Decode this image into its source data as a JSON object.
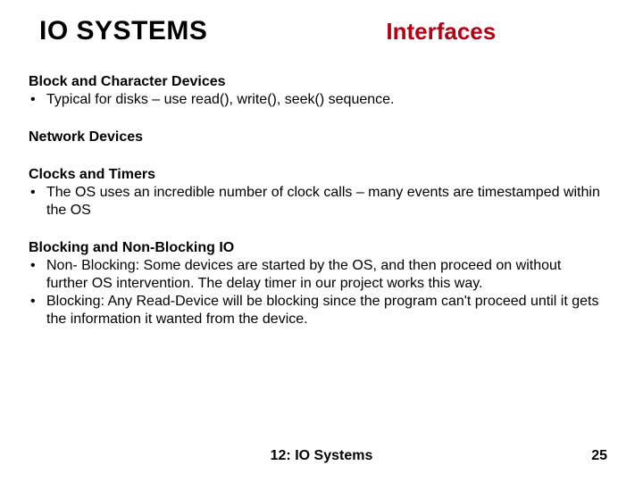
{
  "header": {
    "title_left": "IO SYSTEMS",
    "title_right": "Interfaces"
  },
  "sections": [
    {
      "heading": "Block and Character Devices",
      "bullets": [
        "Typical for disks – use  read(), write(), seek() sequence."
      ]
    },
    {
      "heading": "Network Devices",
      "bullets": []
    },
    {
      "heading": "Clocks and Timers",
      "bullets": [
        "The OS uses an incredible number of clock calls – many events are timestamped within the OS"
      ]
    },
    {
      "heading": "Blocking and Non-Blocking IO",
      "bullets": [
        "Non- Blocking: Some devices are started by the OS, and then proceed on without further OS intervention.  The delay timer in our project works this way.",
        "Blocking:  Any Read-Device will be blocking since the program can't proceed until it gets the information it wanted from the device."
      ]
    }
  ],
  "footer": {
    "center": "12: IO Systems",
    "page": "25"
  },
  "bullet_char": "•"
}
